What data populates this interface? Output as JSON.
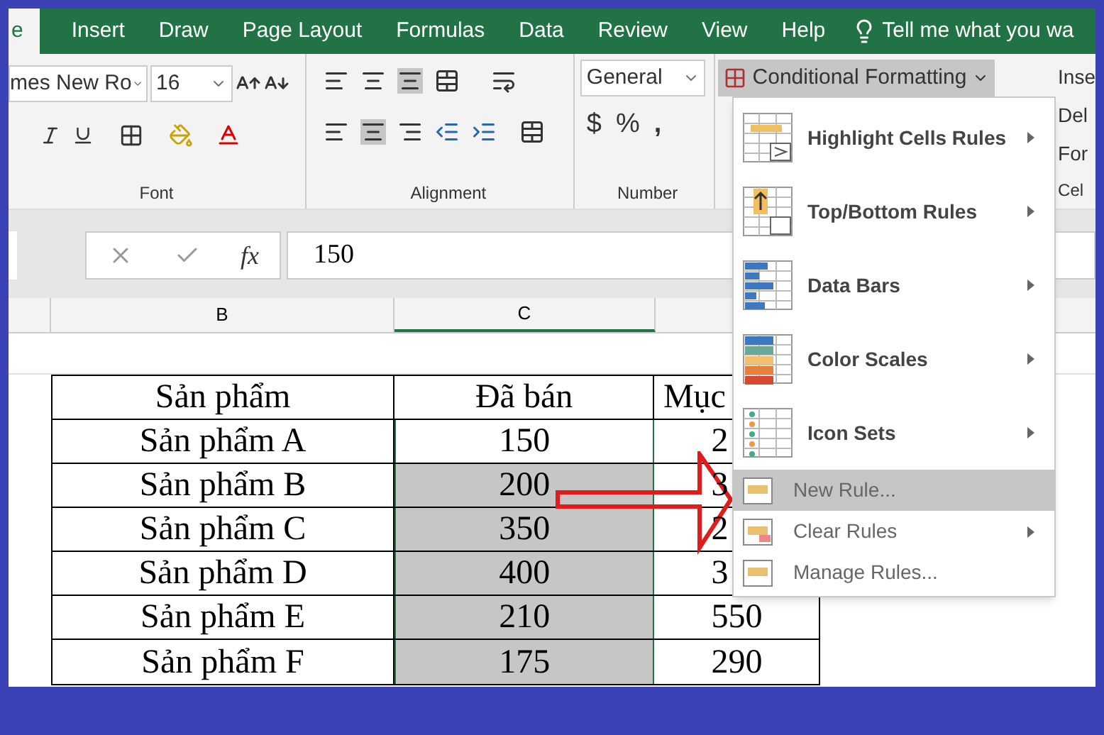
{
  "ribbon_tabs": [
    {
      "label": "e",
      "selected": true
    },
    {
      "label": "Insert",
      "selected": false
    },
    {
      "label": "Draw",
      "selected": false
    },
    {
      "label": "Page Layout",
      "selected": false
    },
    {
      "label": "Formulas",
      "selected": false
    },
    {
      "label": "Data",
      "selected": false
    },
    {
      "label": "Review",
      "selected": false
    },
    {
      "label": "View",
      "selected": false
    },
    {
      "label": "Help",
      "selected": false
    }
  ],
  "tell_me": "Tell me what you wa",
  "font_group": {
    "font_name": "mes New Ro",
    "font_size": "16",
    "label": "Font"
  },
  "alignment_group": {
    "label": "Alignment"
  },
  "number_group": {
    "format": "General",
    "currency": "$",
    "percent": "%",
    "comma": ",",
    "label": "Number"
  },
  "styles_group": {
    "conditional_formatting": "Conditional Formatting",
    "pressed": true
  },
  "cells_group": {
    "insert": "Inse",
    "delete": "Del",
    "format": "For",
    "label": "Cel"
  },
  "formula_bar": {
    "function_label": "fx",
    "value": "150"
  },
  "column_headers": [
    {
      "label": "B",
      "selected": false
    },
    {
      "label": "C",
      "selected": true
    }
  ],
  "table": {
    "columns": [
      "Sản phẩm",
      "Đã bán",
      "Mục"
    ],
    "rows": [
      {
        "cells": [
          "Sản phẩm A",
          "150",
          "2"
        ],
        "shaded": false
      },
      {
        "cells": [
          "Sản phẩm B",
          "200",
          "3"
        ],
        "shaded": true
      },
      {
        "cells": [
          "Sản phẩm C",
          "350",
          "2"
        ],
        "shaded": true
      },
      {
        "cells": [
          "Sản phẩm D",
          "400",
          "3"
        ],
        "shaded": true
      },
      {
        "cells": [
          "Sản phẩm E",
          "210",
          "550"
        ],
        "shaded": true
      },
      {
        "cells": [
          "Sản phẩm F",
          "175",
          "290"
        ],
        "shaded": true
      }
    ]
  },
  "menu": {
    "items": [
      {
        "kind": "highlight",
        "label": "Highlight Cells Rules",
        "submenu": true,
        "highlighted": false
      },
      {
        "kind": "topbottom",
        "label": "Top/Bottom Rules",
        "submenu": true,
        "highlighted": false
      },
      {
        "kind": "databars",
        "label": "Data Bars",
        "submenu": true,
        "highlighted": false
      },
      {
        "kind": "colorscales",
        "label": "Color Scales",
        "submenu": true,
        "highlighted": false
      },
      {
        "kind": "iconsets",
        "label": "Icon Sets",
        "submenu": true,
        "highlighted": false
      },
      {
        "kind": "newrule",
        "label": "New Rule...",
        "submenu": false,
        "highlighted": true
      },
      {
        "kind": "clear",
        "label": "Clear Rules",
        "submenu": true,
        "highlighted": false
      },
      {
        "kind": "manage",
        "label": "Manage Rules...",
        "submenu": false,
        "highlighted": false
      }
    ]
  }
}
